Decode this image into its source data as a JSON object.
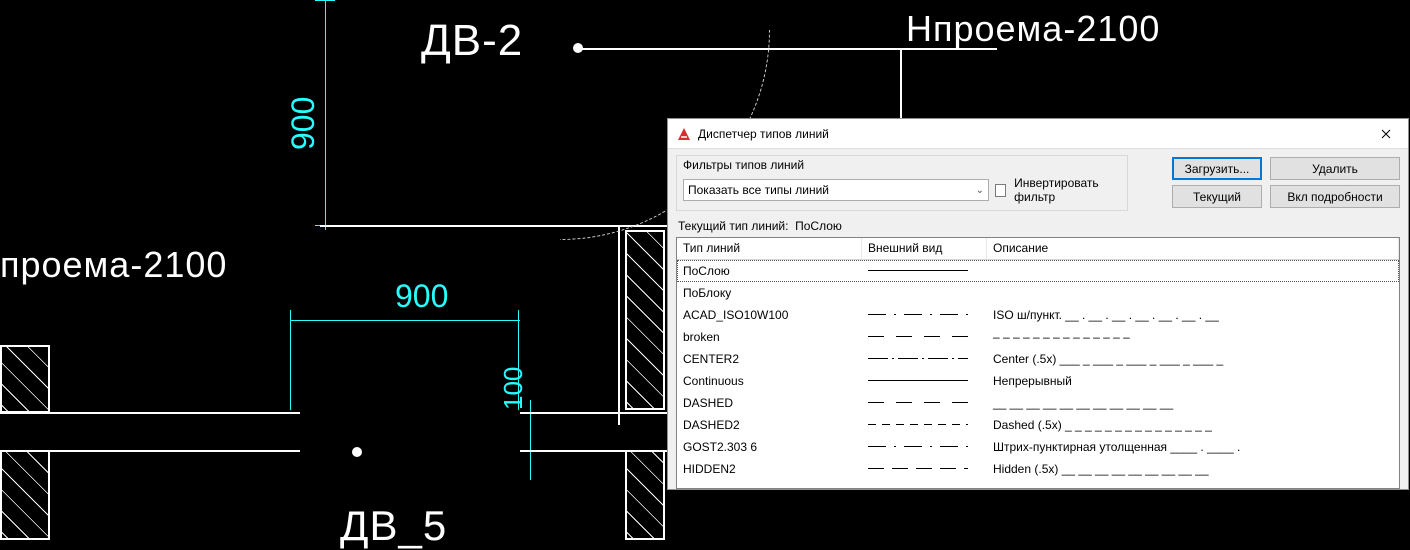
{
  "cad": {
    "label_dv2": "ДВ-2",
    "label_dv5": "ДВ_5",
    "label_hproema_left": "проема-2100",
    "label_hproema_right": "Нпроема-2100",
    "dim_900_v": "900",
    "dim_900_h": "900",
    "dim_100": "100"
  },
  "dialog": {
    "title": "Диспетчер типов линий",
    "filter_group_label": "Фильтры типов линий",
    "combo_value": "Показать все типы линий",
    "invert_label": "Инвертировать фильтр",
    "btn_load": "Загрузить...",
    "btn_delete": "Удалить",
    "btn_current": "Текущий",
    "btn_details": "Вкл подробности",
    "current_label": "Текущий тип линий:",
    "current_value": "ПоСлою",
    "columns": {
      "name": "Тип линий",
      "appearance": "Внешний вид",
      "desc": "Описание"
    },
    "rows": [
      {
        "name": "ПоСлою",
        "style": "lt-continuous",
        "desc": "",
        "selected": true
      },
      {
        "name": "ПоБлоку",
        "style": "",
        "desc": ""
      },
      {
        "name": "ACAD_ISO10W100",
        "style": "lt-iso",
        "desc": "ISO ш/пункт. __ . __ . __ . __ . __ . __ . __"
      },
      {
        "name": "broken",
        "style": "lt-dashed",
        "desc": "– – – – – – – – – – – – – –"
      },
      {
        "name": "CENTER2",
        "style": "lt-center2",
        "desc": "Center (.5x) ___ _ ___ _ ___ _ ___ _ ___ _"
      },
      {
        "name": "Continuous",
        "style": "lt-continuous",
        "desc": "Непрерывный"
      },
      {
        "name": "DASHED",
        "style": "lt-dashed",
        "desc": "__ __ __ __ __ __ __ __ __ __ __"
      },
      {
        "name": "DASHED2",
        "style": "lt-dashed2",
        "desc": "Dashed (.5x) _ _ _ _ _ _ _ _ _ _ _ _ _ _ _"
      },
      {
        "name": "GOST2.303 6",
        "style": "lt-iso",
        "desc": "Штрих-пунктирная утолщенная ____  .  ____  ."
      },
      {
        "name": "HIDDEN2",
        "style": "lt-hidden2",
        "desc": "Hidden (.5x) __ __ __ __ __ __ __ __ __"
      }
    ]
  }
}
